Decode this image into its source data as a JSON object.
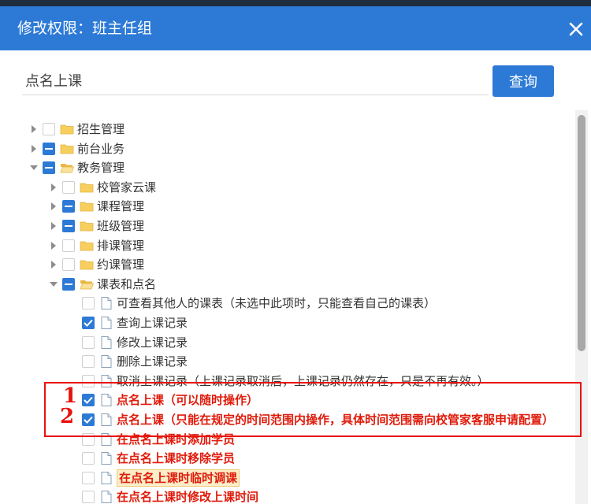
{
  "dialog": {
    "title": "修改权限：班主任组",
    "close_icon": "close-icon"
  },
  "search": {
    "value": "点名上课",
    "button_label": "查询"
  },
  "colors": {
    "header_bg": "#2d7ad6",
    "checkbox_blue": "#2d7ad6",
    "bold_red": "#e01b0b",
    "annotation_red": "#e8120c",
    "folder_yellow": "#f7cf5f"
  },
  "tree": [
    {
      "label": "招生管理",
      "level": 0,
      "arrow": "right",
      "check": "none",
      "icon": "folder-icon"
    },
    {
      "label": "前台业务",
      "level": 0,
      "arrow": "right",
      "check": "partial",
      "icon": "folder-icon"
    },
    {
      "label": "教务管理",
      "level": 0,
      "arrow": "down",
      "check": "partial",
      "icon": "folder-open-icon"
    },
    {
      "label": "校管家云课",
      "level": 1,
      "arrow": "right",
      "check": "none",
      "icon": "folder-icon"
    },
    {
      "label": "课程管理",
      "level": 1,
      "arrow": "right",
      "check": "partial",
      "icon": "folder-icon"
    },
    {
      "label": "班级管理",
      "level": 1,
      "arrow": "right",
      "check": "partial",
      "icon": "folder-icon"
    },
    {
      "label": "排课管理",
      "level": 1,
      "arrow": "right",
      "check": "none",
      "icon": "folder-icon"
    },
    {
      "label": "约课管理",
      "level": 1,
      "arrow": "right",
      "check": "none",
      "icon": "folder-icon"
    },
    {
      "label": "课表和点名",
      "level": 1,
      "arrow": "down",
      "check": "partial",
      "icon": "folder-open-icon"
    },
    {
      "label": "可查看其他人的课表（未选中此项时，只能查看自己的课表）",
      "level": 2,
      "arrow": "none",
      "check": "none",
      "icon": "document-icon"
    },
    {
      "label": "查询上课记录",
      "level": 2,
      "arrow": "none",
      "check": "checked",
      "icon": "document-icon"
    },
    {
      "label": "修改上课记录",
      "level": 2,
      "arrow": "none",
      "check": "none",
      "icon": "document-icon"
    },
    {
      "label": "删除上课记录",
      "level": 2,
      "arrow": "none",
      "check": "none",
      "icon": "document-icon"
    },
    {
      "label": "取消上课记录（上课记录取消后，上课记录仍然存在，只是不再有效。）",
      "level": 2,
      "arrow": "none",
      "check": "none",
      "icon": "document-icon"
    },
    {
      "label": "点名上课（可以随时操作）",
      "level": 2,
      "arrow": "none",
      "check": "checked",
      "icon": "document-icon",
      "style": "bold"
    },
    {
      "label": "点名上课（只能在规定的时间范围内操作，具体时间范围需向校管家客服申请配置）",
      "level": 2,
      "arrow": "none",
      "check": "checked",
      "icon": "document-icon",
      "style": "bold"
    },
    {
      "label": "在点名上课时添加学员",
      "level": 2,
      "arrow": "none",
      "check": "none",
      "icon": "document-icon",
      "style": "bold"
    },
    {
      "label": "在点名上课时移除学员",
      "level": 2,
      "arrow": "none",
      "check": "none",
      "icon": "document-icon",
      "style": "bold"
    },
    {
      "label": "在点名上课时临时调课",
      "level": 2,
      "arrow": "none",
      "check": "none",
      "icon": "document-icon",
      "style": "bold-highlight"
    },
    {
      "label": "在点名上课时修改上课时间",
      "level": 2,
      "arrow": "none",
      "check": "none",
      "icon": "document-icon",
      "style": "bold"
    }
  ],
  "annotations": {
    "num1": "1",
    "num2": "2"
  }
}
